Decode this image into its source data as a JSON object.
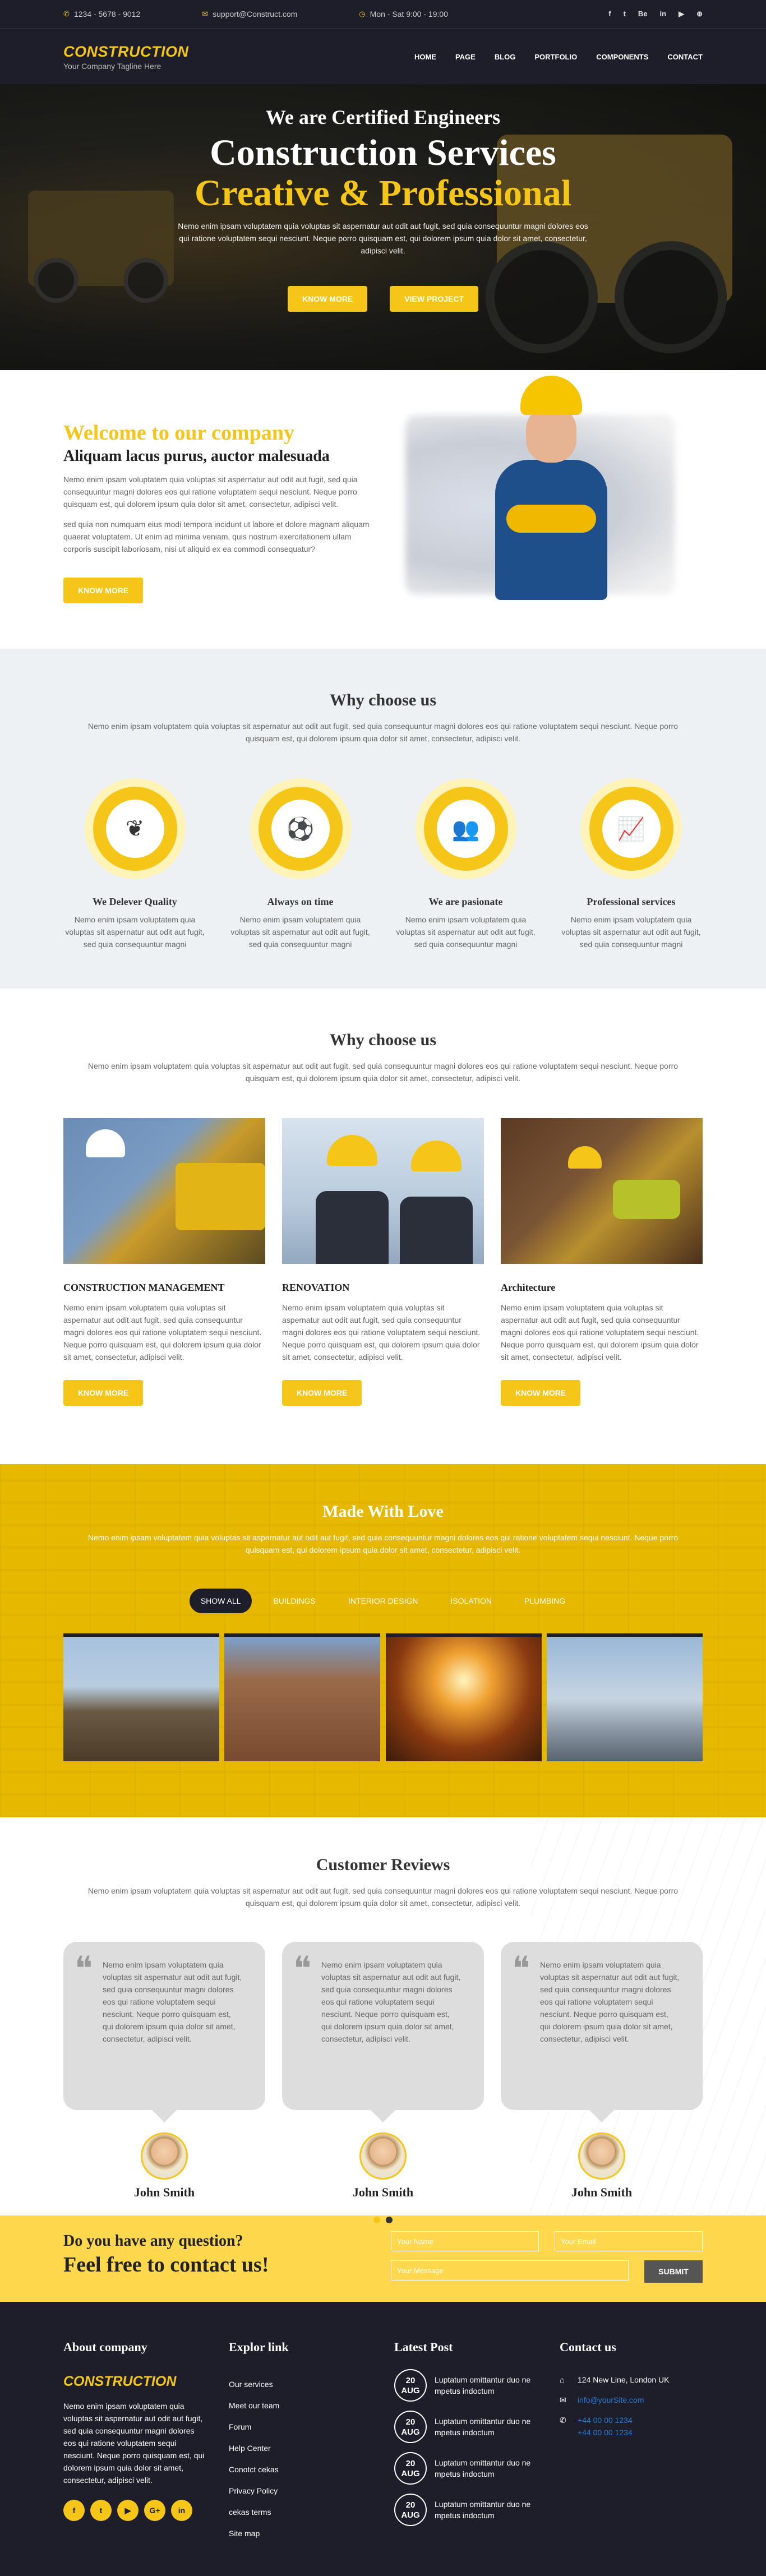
{
  "topbar": {
    "phone": "1234 - 5678 - 9012",
    "email": "support@Construct.com",
    "hours": "Mon - Sat 9:00 - 19:00",
    "socials": [
      "f",
      "t",
      "Be",
      "in",
      "▶",
      "⊕"
    ]
  },
  "header": {
    "logo": "CONSTRUCTION",
    "tagline": "Your Company Tagline Here",
    "nav": [
      "HOME",
      "PAGE",
      "BLOG",
      "PORTFOLIO",
      "COMPONENTS",
      "CONTACT"
    ]
  },
  "hero": {
    "kicker": "We are Certified Engineers",
    "title": "Construction Services",
    "subtitle": "Creative & Professional",
    "text": "Nemo enim ipsam voluptatem quia voluptas sit aspernatur aut odit aut fugit, sed quia consequuntur magni dolores eos qui ratione voluptatem sequi nesciunt. Neque porro quisquam est, qui dolorem ipsum quia dolor sit amet, consectetur, adipisci velit.",
    "btn1": "KNOW MORE",
    "btn2": "VIEW PROJECT"
  },
  "welcome": {
    "title": "Welcome to our company",
    "subtitle": "Aliquam lacus purus, auctor malesuada",
    "p1": "Nemo enim ipsam voluptatem quia voluptas sit aspernatur aut odit aut fugit, sed quia consequuntur magni dolores eos qui ratione voluptatem sequi nesciunt. Neque porro quisquam est, qui dolorem ipsum quia dolor sit amet, consectetur, adipisci velit.",
    "p2": "sed quia non numquam eius modi tempora incidunt ut labore et dolore magnam aliquam quaerat voluptatem. Ut enim ad minima veniam, quis nostrum exercitationem ullam corporis suscipit laboriosam, nisi ut aliquid ex ea commodi consequatur?",
    "btn": "KNOW MORE"
  },
  "why1": {
    "title": "Why choose us",
    "desc": "Nemo enim ipsam voluptatem quia voluptas sit aspernatur aut odit aut fugit, sed quia consequuntur magni dolores eos qui ratione voluptatem sequi nesciunt. Neque porro quisquam est, qui dolorem ipsum quia dolor sit amet, consectetur, adipisci velit.",
    "features": [
      {
        "icon": "leaf-icon",
        "glyph": "❦",
        "title": "We Delever Quality",
        "text": "Nemo enim ipsam voluptatem quia voluptas sit aspernatur aut odit aut fugit, sed quia consequuntur magni"
      },
      {
        "icon": "ball-icon",
        "glyph": "⚽",
        "title": "Always on time",
        "text": "Nemo enim ipsam voluptatem quia voluptas sit aspernatur aut odit aut fugit, sed quia consequuntur magni"
      },
      {
        "icon": "group-icon",
        "glyph": "👥",
        "title": "We are pasionate",
        "text": "Nemo enim ipsam voluptatem quia voluptas sit aspernatur aut odit aut fugit, sed quia consequuntur magni"
      },
      {
        "icon": "chart-icon",
        "glyph": "📈",
        "title": "Professional services",
        "text": "Nemo enim ipsam voluptatem quia voluptas sit aspernatur aut odit aut fugit, sed quia consequuntur magni"
      }
    ]
  },
  "why2": {
    "title": "Why choose us",
    "desc": "Nemo enim ipsam voluptatem quia voluptas sit aspernatur aut odit aut fugit, sed quia consequuntur magni dolores eos qui ratione voluptatem sequi nesciunt. Neque porro quisquam est, qui dolorem ipsum quia dolor sit amet, consectetur, adipisci velit.",
    "services": [
      {
        "title": "CONSTRUCTION MANAGEMENT",
        "text": "Nemo enim ipsam voluptatem quia voluptas sit aspernatur aut odit aut fugit, sed quia consequuntur magni dolores eos qui ratione voluptatem sequi nesciunt. Neque porro quisquam est, qui dolorem ipsum quia dolor sit amet, consectetur, adipisci velit.",
        "btn": "KNOW MORE"
      },
      {
        "title": "RENOVATION",
        "text": "Nemo enim ipsam voluptatem quia voluptas sit aspernatur aut odit aut fugit, sed quia consequuntur magni dolores eos qui ratione voluptatem sequi nesciunt. Neque porro quisquam est, qui dolorem ipsum quia dolor sit amet, consectetur, adipisci velit.",
        "btn": "KNOW MORE"
      },
      {
        "title": "Architecture",
        "text": "Nemo enim ipsam voluptatem quia voluptas sit aspernatur aut odit aut fugit, sed quia consequuntur magni dolores eos qui ratione voluptatem sequi nesciunt. Neque porro quisquam est, qui dolorem ipsum quia dolor sit amet, consectetur, adipisci velit.",
        "btn": "KNOW MORE"
      }
    ]
  },
  "love": {
    "title": "Made With Love",
    "desc": "Nemo enim ipsam voluptatem quia voluptas sit aspernatur aut odit aut fugit, sed quia consequuntur magni dolores eos qui ratione voluptatem sequi nesciunt. Neque porro quisquam est, qui dolorem ipsum quia dolor sit amet, consectetur, adipisci velit.",
    "filters": [
      "SHOW ALL",
      "BUILDINGS",
      "INTERIOR DESIGN",
      "ISOLATION",
      "PLUMBING"
    ]
  },
  "reviews": {
    "title": "Customer Reviews",
    "desc": "Nemo enim ipsam voluptatem quia voluptas sit aspernatur aut odit aut fugit, sed quia consequuntur magni dolores eos qui ratione voluptatem sequi nesciunt. Neque porro quisquam est, qui dolorem ipsum quia dolor sit amet, consectetur, adipisci velit.",
    "items": [
      {
        "text": "Nemo enim ipsam voluptatem quia voluptas sit aspernatur aut odit aut fugit, sed quia consequuntur magni dolores eos qui ratione voluptatem sequi nesciunt. Neque porro quisquam est, qui dolorem ipsum quia dolor sit amet, consectetur, adipisci velit.",
        "name": "John Smith"
      },
      {
        "text": "Nemo enim ipsam voluptatem quia voluptas sit aspernatur aut odit aut fugit, sed quia consequuntur magni dolores eos qui ratione voluptatem sequi nesciunt. Neque porro quisquam est, qui dolorem ipsum quia dolor sit amet, consectetur, adipisci velit.",
        "name": "John Smith"
      },
      {
        "text": "Nemo enim ipsam voluptatem quia voluptas sit aspernatur aut odit aut fugit, sed quia consequuntur magni dolores eos qui ratione voluptatem sequi nesciunt. Neque porro quisquam est, qui dolorem ipsum quia dolor sit amet, consectetur, adipisci velit.",
        "name": "John Smith"
      }
    ]
  },
  "contact": {
    "q": "Do you have any question?",
    "cta": "Feel free to contact us!",
    "name_ph": "Your Name",
    "email_ph": "Your Email",
    "msg_ph": "Your Message",
    "submit": "SUBMIT"
  },
  "footer": {
    "about_title": "About company",
    "logo": "CONSTRUCTION",
    "about_text": "Nemo enim ipsam voluptatem quia voluptas sit aspernatur aut odit aut fugit, sed quia consequuntur magni dolores eos qui ratione voluptatem sequi nesciunt. Neque porro quisquam est, qui dolorem ipsum quia dolor sit amet, consectetur, adipisci velit.",
    "social": [
      "f",
      "t",
      "▶",
      "G+",
      "in"
    ],
    "links_title": "Explor link",
    "links": [
      "Our services",
      "Meet our team",
      "Forum",
      "Help Center",
      "Conotct cekas",
      "Privacy Policy",
      "cekas terms",
      "Site map"
    ],
    "posts_title": "Latest Post",
    "posts": [
      {
        "day": "20",
        "month": "AUG",
        "text": "Luptatum omittantur duo ne mpetus indoctum"
      },
      {
        "day": "20",
        "month": "AUG",
        "text": "Luptatum omittantur duo ne mpetus indoctum"
      },
      {
        "day": "20",
        "month": "AUG",
        "text": "Luptatum omittantur duo ne mpetus indoctum"
      },
      {
        "day": "20",
        "month": "AUG",
        "text": "Luptatum omittantur duo ne mpetus indoctum"
      }
    ],
    "contact_title": "Contact us",
    "address": "124 New Line, London UK",
    "email": "info@yourSite.com",
    "phone1": "+44 00 00 1234",
    "phone2": "+44 00 00 1234"
  }
}
